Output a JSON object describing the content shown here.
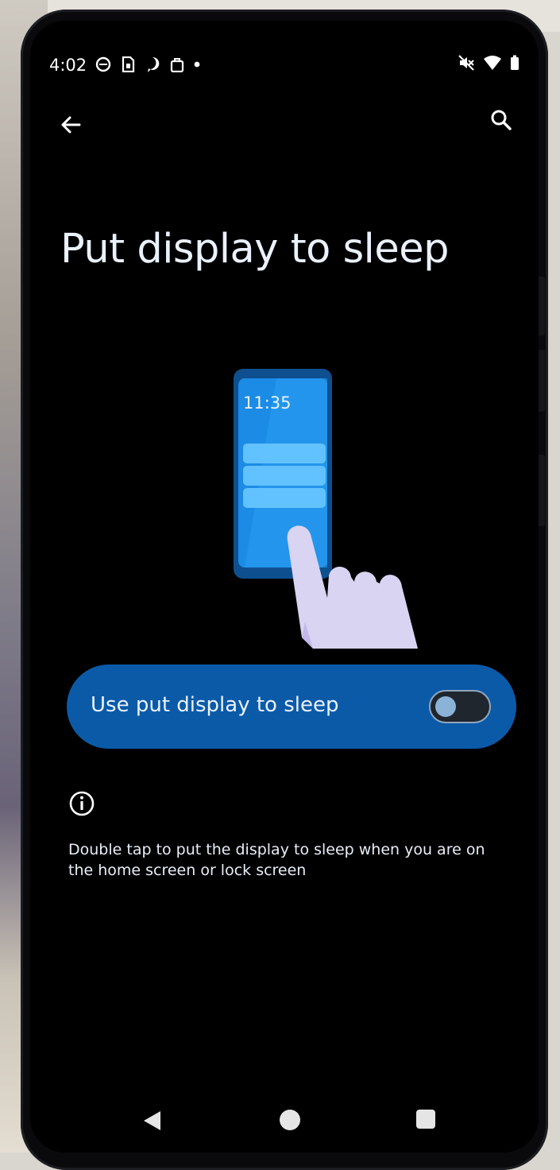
{
  "status_bar": {
    "time": "4:02",
    "left_icons": [
      "messenger-icon",
      "sim-icon",
      "chat-icon",
      "bag-icon",
      "dot-icon"
    ],
    "right_icons": [
      "mute-icon",
      "wifi-icon",
      "battery-icon"
    ]
  },
  "toolbar": {
    "back_icon": "arrow-left-icon",
    "search_icon": "search-icon"
  },
  "page": {
    "title": "Put display to sleep"
  },
  "illustration": {
    "clock_text": "11:35"
  },
  "setting": {
    "label": "Use put display to sleep",
    "enabled": false
  },
  "info": {
    "icon": "info-icon",
    "description": "Double tap to put the display to sleep when you are on the home screen or lock screen"
  },
  "nav_bar": {
    "icons": [
      "back-triangle-icon",
      "home-circle-icon",
      "recents-square-icon"
    ]
  },
  "colors": {
    "background": "#000000",
    "card": "#0b5aa8",
    "title_text": "#eaf1ff"
  }
}
